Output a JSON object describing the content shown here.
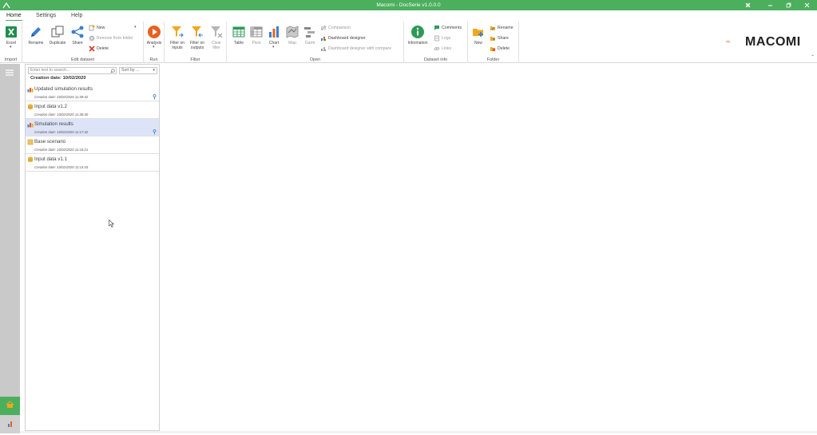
{
  "window": {
    "title": "Macomi - DocSerie v1.0.0.0",
    "controls": [
      "pin",
      "minimize",
      "restore",
      "close"
    ]
  },
  "menu": {
    "tabs": [
      {
        "label": "Home",
        "active": true
      },
      {
        "label": "Settings",
        "active": false
      },
      {
        "label": "Help",
        "active": false
      }
    ]
  },
  "ribbon": {
    "groups": {
      "import": {
        "label": "Import",
        "excel": "Excel"
      },
      "edit_dataset": {
        "label": "Edit dataset",
        "rename": "Rename",
        "duplicate": "Duplicate",
        "share": "Share",
        "new": "New",
        "remove_from_folder": "Remove from folder",
        "delete": "Delete"
      },
      "run": {
        "label": "Run",
        "analysis": "Analysis"
      },
      "filter": {
        "label": "Filter",
        "filter_inputs_1": "Filter on",
        "filter_inputs_2": "inputs",
        "filter_outputs_1": "Filter on",
        "filter_outputs_2": "outputs",
        "clear_filter_1": "Clear",
        "clear_filter_2": "filter"
      },
      "open": {
        "label": "Open",
        "table": "Table",
        "pivot": "Pivot",
        "chart": "Chart",
        "map": "Map",
        "gantt": "Gantt",
        "comparison": "Comparison",
        "dashboard_designer": "Dashboard designer",
        "dashboard_designer_compare": "Dashboard designer with compare"
      },
      "dataset_info": {
        "label": "Dataset info",
        "information": "Information",
        "comments": "Comments",
        "logs": "Logs",
        "links": "Links"
      },
      "folder": {
        "label": "Folder",
        "new": "New",
        "rename": "Rename",
        "share": "Share",
        "delete": "Delete"
      }
    },
    "logo_text": "MACOMI",
    "accent": "#4caf5e"
  },
  "datasets": {
    "search_placeholder": "Enter text to search...",
    "sort_label": "Sort by ...",
    "group_header": "Creation date: 10/02/2020",
    "items": [
      {
        "name": "Updated simulation results",
        "date": "Creation date: 10/02/2020 11:39:42",
        "icon": "chart-dataset-icon",
        "pinned": true,
        "selected": false
      },
      {
        "name": "Input data v1.2",
        "date": "Creation date: 10/02/2020 11:38:40",
        "icon": "database-icon",
        "pinned": false,
        "selected": false
      },
      {
        "name": "Simulation results",
        "date": "Creation date: 10/02/2020 11:17:42",
        "icon": "chart-dataset-icon",
        "pinned": true,
        "selected": true
      },
      {
        "name": "Base scenario",
        "date": "Creation date: 10/02/2020 11:16:21",
        "icon": "scenario-icon",
        "pinned": false,
        "selected": false
      },
      {
        "name": "Input data v1.1",
        "date": "Creation date: 10/02/2020 11:14:43",
        "icon": "database-icon",
        "pinned": false,
        "selected": false
      }
    ]
  }
}
